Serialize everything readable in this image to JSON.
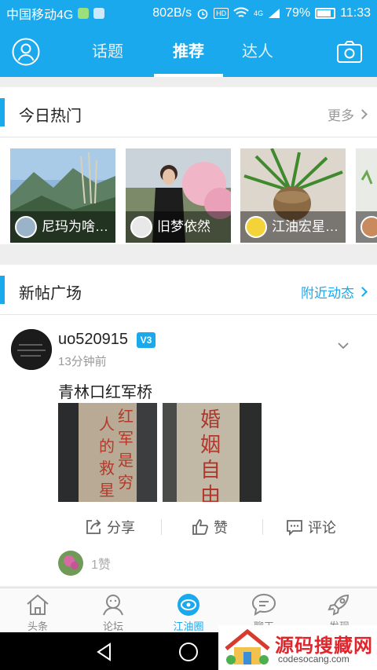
{
  "status_bar": {
    "carrier": "中国移动4G",
    "speed": "802B/s",
    "hd": "HD",
    "network": "4G",
    "battery": "79%",
    "time": "11:33"
  },
  "top_nav": {
    "tabs": [
      {
        "label": "话题"
      },
      {
        "label": "推荐"
      },
      {
        "label": "达人"
      }
    ],
    "active_tab": "推荐",
    "accent_color": "#1aa9ec"
  },
  "hot_today": {
    "title": "今日热门",
    "more_label": "更多",
    "items": [
      {
        "name": "尼玛为啥…"
      },
      {
        "name": "旧梦依然"
      },
      {
        "name": "江油宏星…"
      }
    ]
  },
  "new_posts": {
    "title": "新帖广场",
    "nearby_label": "附近动态",
    "post": {
      "username": "uo520915",
      "badge": "V3",
      "time": "13分钟前",
      "text": "青林口红军桥",
      "image_captions": [
        "红军是穷人的救星",
        "婚姻自由"
      ],
      "share_label": "分享",
      "like_label": "赞",
      "comment_label": "评论",
      "like_count": "1赞"
    }
  },
  "bottom_nav": {
    "items": [
      {
        "label": "头条",
        "icon": "home-icon"
      },
      {
        "label": "论坛",
        "icon": "forum-icon"
      },
      {
        "label": "江油圈",
        "icon": "circle-eye-icon"
      },
      {
        "label": "聊天",
        "icon": "chat-icon"
      },
      {
        "label": "发现",
        "icon": "rocket-icon"
      }
    ],
    "active": "江油圈"
  },
  "watermark": {
    "title": "源码搜藏网",
    "subtitle": "codesocang.com"
  }
}
